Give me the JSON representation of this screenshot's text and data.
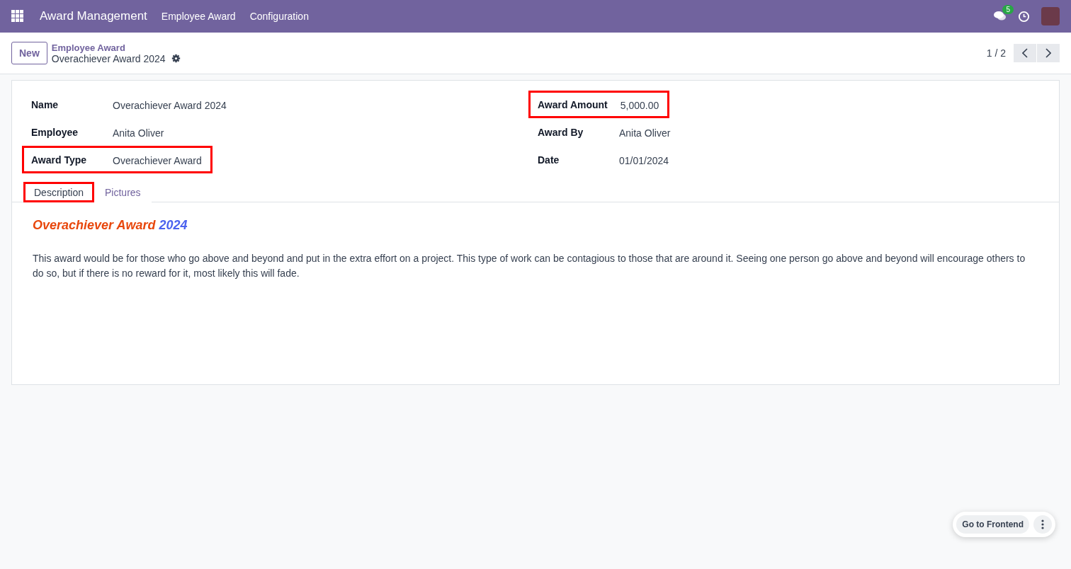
{
  "navbar": {
    "app_name": "Award Management",
    "menu": [
      "Employee Award",
      "Configuration"
    ],
    "message_count": "5"
  },
  "control_panel": {
    "new_button": "New",
    "breadcrumb": "Employee Award",
    "record_title": "Overachiever Award 2024",
    "pager": "1 / 2"
  },
  "fields_left": [
    {
      "label": "Name",
      "value": "Overachiever Award 2024",
      "highlighted": false
    },
    {
      "label": "Employee",
      "value": "Anita Oliver",
      "highlighted": false
    },
    {
      "label": "Award Type",
      "value": "Overachiever Award",
      "highlighted": true
    }
  ],
  "fields_right": [
    {
      "label": "Award Amount",
      "value": "5,000.00",
      "highlighted": true
    },
    {
      "label": "Award By",
      "value": "Anita Oliver",
      "highlighted": false
    },
    {
      "label": "Date",
      "value": "01/01/2024",
      "highlighted": false
    }
  ],
  "tabs": [
    {
      "label": "Description",
      "selected": true,
      "highlighted": true
    },
    {
      "label": "Pictures",
      "selected": false,
      "highlighted": false
    }
  ],
  "description": {
    "heading": [
      {
        "text": "Overachiever Award",
        "color": "#e8470c"
      },
      {
        "text": "2024",
        "color": "#4b62ef"
      }
    ],
    "body": "This award would be for those who go above and beyond and put in the extra effort on a project. This type of work can be contagious to those that are around it. Seeing one person go above and beyond will encourage others to do so, but if there is no reward for it, most likely this will fade."
  },
  "floating": {
    "button": "Go to Frontend"
  }
}
